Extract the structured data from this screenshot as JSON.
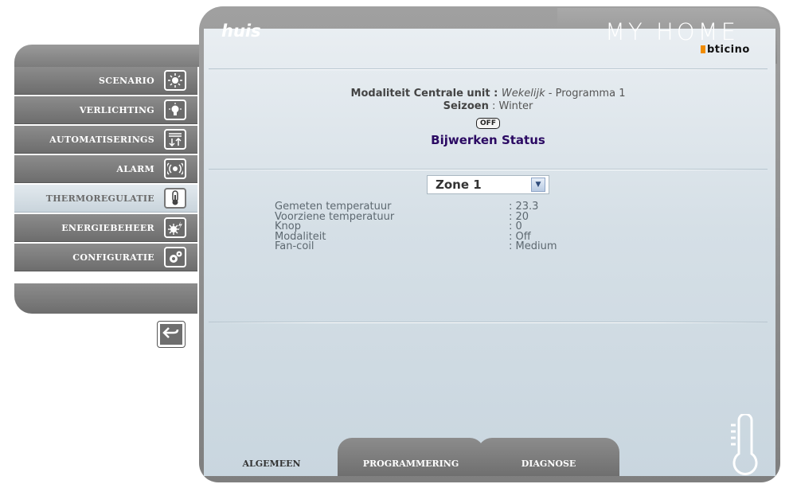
{
  "header": {
    "page_title": "huis",
    "brand": "MY HOME",
    "brand_sub": "bticino"
  },
  "sidebar": {
    "items": [
      {
        "label": "SCENARIO",
        "icon": "scenario-icon",
        "active": false
      },
      {
        "label": "VERLICHTING",
        "icon": "light-bulb-icon",
        "active": false
      },
      {
        "label": "AUTOMATISERINGS",
        "icon": "automation-icon",
        "active": false
      },
      {
        "label": "ALARM",
        "icon": "alarm-icon",
        "active": false
      },
      {
        "label": "THERMOREGULATIE",
        "icon": "thermometer-icon",
        "active": true
      },
      {
        "label": "ENERGIEBEHEER",
        "icon": "energy-icon",
        "active": false
      },
      {
        "label": "CONFIGURATIE",
        "icon": "gear-icon",
        "active": false
      }
    ],
    "back_icon": "back-arrow-icon"
  },
  "status": {
    "mode_label": "Modaliteit Centrale unit",
    "mode_sep": " : ",
    "mode_value": "Wekelijk",
    "mode_program": " - Programma 1",
    "season_label": "Seizoen",
    "season_sep": " : ",
    "season_value": "Winter",
    "off_badge": "OFF",
    "update_link": "Bijwerken Status"
  },
  "zone": {
    "selected": "Zone 1"
  },
  "info": [
    {
      "label": "Gemeten temperatuur",
      "value": ": 23.3"
    },
    {
      "label": "Voorziene temperatuur",
      "value": ": 20"
    },
    {
      "label": "Knop",
      "value": ": 0"
    },
    {
      "label": "Modaliteit",
      "value": ": Off"
    },
    {
      "label": "Fan-coil",
      "value": ": Medium"
    }
  ],
  "tabs": {
    "general": "ALGEMEEN",
    "programming": "PROGRAMMERING",
    "diagnose": "DIAGNOSE"
  },
  "colors": {
    "accent_link": "#2b0a63",
    "brand_orange": "#f08c00",
    "sidebar_gray": "#7c7c7c"
  }
}
